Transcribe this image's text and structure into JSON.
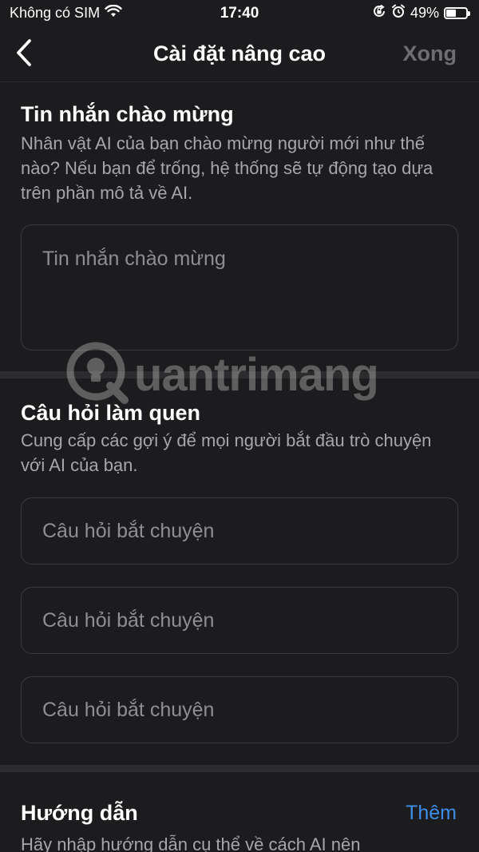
{
  "status_bar": {
    "carrier": "Không có SIM",
    "time": "17:40",
    "battery": "49%",
    "battery_level": 0.49,
    "icons": [
      "wifi-icon",
      "orientation-lock-icon",
      "alarm-icon",
      "battery-icon"
    ]
  },
  "nav": {
    "back_icon": "chevron-left-icon",
    "title": "Cài đặt nâng cao",
    "done_label": "Xong",
    "done_color": "#6d6d72"
  },
  "welcome": {
    "title": "Tin nhắn chào mừng",
    "description": "Nhân vật AI của bạn chào mừng người mới như thế nào? Nếu bạn để trống, hệ thống sẽ tự động tạo dựa trên phần mô tả về AI.",
    "placeholder": "Tin nhắn chào mừng"
  },
  "starters": {
    "title": "Câu hỏi làm quen",
    "description": "Cung cấp các gợi ý để mọi người bắt đầu trò chuyện với AI của bạn.",
    "inputs": [
      {
        "placeholder": "Câu hỏi bắt chuyện"
      },
      {
        "placeholder": "Câu hỏi bắt chuyện"
      },
      {
        "placeholder": "Câu hỏi bắt chuyện"
      }
    ]
  },
  "instructions": {
    "title": "Hướng dẫn",
    "add_label": "Thêm",
    "add_color": "#3d8ee8",
    "description": "Hãy nhập hướng dẫn cụ thể về cách AI nên"
  },
  "watermark": {
    "text": "uantrimang"
  }
}
